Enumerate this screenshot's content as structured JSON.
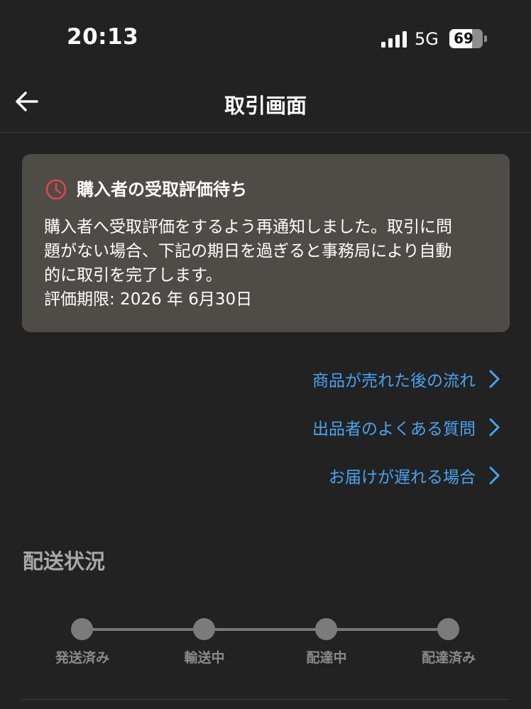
{
  "status_bar": {
    "time": "20:13",
    "network": "5G",
    "battery": "69",
    "battery_level": 0.69
  },
  "nav": {
    "title": "取引画面",
    "back_icon": "arrow-left-icon"
  },
  "notice": {
    "icon": "clock-icon",
    "icon_color": "#e0464b",
    "title": "購入者の受取評価待ち",
    "body_line1": "購入者へ受取評価をするよう再通知しました。取引に問",
    "body_line2": "題がない場合、下記の期日を過ぎると事務局により自動",
    "body_line3": "的に取引を完了します。",
    "deadline": "評価期限: 2026 年 6月30日"
  },
  "links": [
    {
      "label": "商品が売れた後の流れ",
      "icon": "chevron-right-icon"
    },
    {
      "label": "出品者のよくある質問",
      "icon": "chevron-right-icon"
    },
    {
      "label": "お届けが遅れる場合",
      "icon": "chevron-right-icon"
    }
  ],
  "delivery": {
    "title": "配送状況",
    "steps": [
      "発送済み",
      "輸送中",
      "配達中",
      "配達済み"
    ]
  },
  "colors": {
    "background": "#222222",
    "card": "#4d4c47",
    "link": "#4aa3f0",
    "muted": "#8a8a8a"
  }
}
